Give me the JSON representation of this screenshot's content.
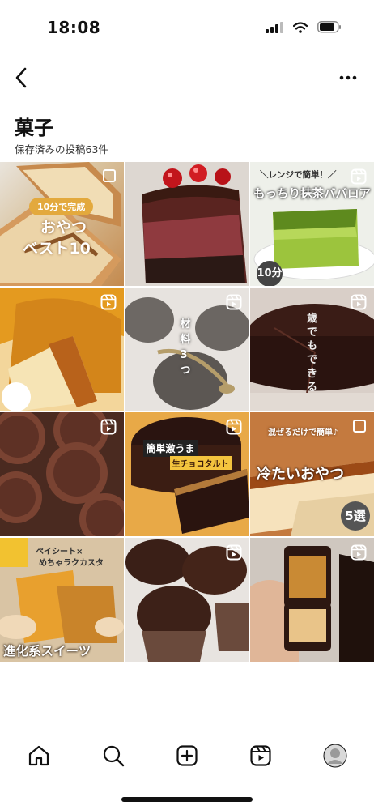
{
  "status": {
    "time": "18:08"
  },
  "collection": {
    "title": "菓子",
    "subtitle": "保存済みの投稿63件"
  },
  "icons": {
    "back": "chevron-left-icon",
    "more": "more-horizontal-icon",
    "reel": "reel-icon",
    "multi": "square-outline-icon"
  },
  "posts": [
    {
      "id": "p1",
      "texts": [
        "10分で完成",
        "おやつ",
        "ベスト10"
      ],
      "badge": "square-outline-icon"
    },
    {
      "id": "p2",
      "texts": [],
      "badge": "none"
    },
    {
      "id": "p3",
      "texts": [
        "＼レンジで簡単！／",
        "もっちり抹茶ババロア",
        "10分"
      ],
      "badge": "reel-icon"
    },
    {
      "id": "p4",
      "texts": [],
      "badge": "reel-icon"
    },
    {
      "id": "p5",
      "texts": [
        "材料3つ"
      ],
      "badge": "reel-icon"
    },
    {
      "id": "p6",
      "texts": [
        "歳でもできる"
      ],
      "badge": "reel-icon"
    },
    {
      "id": "p7",
      "texts": [],
      "badge": "reel-icon"
    },
    {
      "id": "p8",
      "texts": [
        "簡単激うま",
        "生チョコタルト"
      ],
      "badge": "reel-icon"
    },
    {
      "id": "p9",
      "texts": [
        "混ぜるだけで簡単♪",
        "冷たいおやつ",
        "5選"
      ],
      "badge": "square-outline-icon"
    },
    {
      "id": "p10",
      "texts": [
        "ペイシート×",
        "めちゃラクカスタ",
        "進化系スイーツ"
      ],
      "badge": "none"
    },
    {
      "id": "p11",
      "texts": [],
      "badge": "reel-icon"
    },
    {
      "id": "p12",
      "texts": [],
      "badge": "reel-icon"
    }
  ],
  "tabbar": {
    "items": [
      "home-icon",
      "search-icon",
      "create-icon",
      "reels-icon",
      "profile-avatar"
    ]
  }
}
